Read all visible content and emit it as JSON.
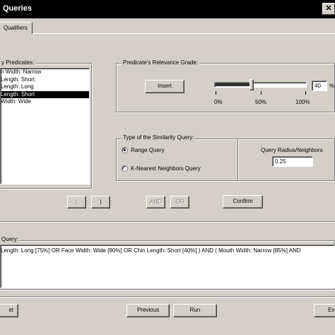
{
  "window": {
    "title": "Queries",
    "close_glyph": "✕"
  },
  "tabs": [
    {
      "label": "Qualifiers"
    }
  ],
  "predicates": {
    "label": "y Predicates:",
    "items": [
      "n Width: Narrow",
      "Length: Short",
      "Length: Long",
      "Length: Short",
      "Width: Wide"
    ],
    "selected_index": 3
  },
  "relevance": {
    "label": "Predicate's Relevance Grade:",
    "insert_label": "Insert",
    "value": 40,
    "value_text": "40",
    "unit": "%",
    "ticks": [
      "0%",
      "50%",
      "100%"
    ]
  },
  "similarity": {
    "label": "Type of the Similarity Query:",
    "options": [
      {
        "label": "Range Query",
        "selected": true
      },
      {
        "label": "K-Nearest Neighbors Query",
        "selected": false
      }
    ],
    "radius_label": "Query Radius/Neighbors",
    "radius_value": "0.25"
  },
  "operators": {
    "open_paren": "(",
    "close_paren": ")",
    "and_label": "AND",
    "or_label": "OR",
    "confirm_label": "Confirm"
  },
  "query": {
    "label": "Query:",
    "text": "Length: Long [75%] OR Face Width: Wide [90%] OR Chin Length: Short [40%] )  AND  ( Mouth Width: Narrow [85%] AND"
  },
  "footer": {
    "reset_label": "et",
    "previous_label": "Previous",
    "run_label": "Run",
    "exit_label": "Ex"
  }
}
